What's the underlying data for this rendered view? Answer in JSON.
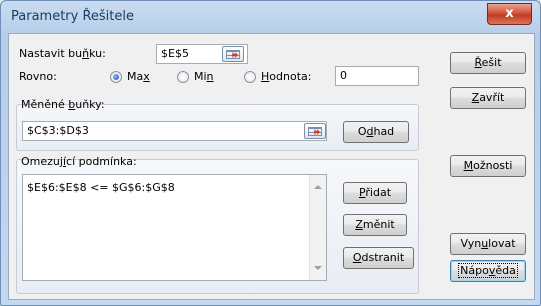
{
  "window": {
    "title": "Parametry Řešitele",
    "close_glyph": "x"
  },
  "target_cell": {
    "label": "Nastavit buňku:",
    "value": "$E$5"
  },
  "equal_to": {
    "label": "Rovno:",
    "options": [
      {
        "label": "Max",
        "checked": true
      },
      {
        "label": "Min",
        "checked": false
      },
      {
        "label": "Hodnota:",
        "checked": false
      }
    ],
    "value_field": "0"
  },
  "changing_cells": {
    "label": "Měněné buňky:",
    "value": "$C$3:$D$3",
    "guess_button": "Odhad"
  },
  "constraints": {
    "label": "Omezující podmínka:",
    "items": [
      "$E$6:$E$8 <= $G$6:$G$8"
    ],
    "add_button": "Přidat",
    "change_button": "Změnit",
    "delete_button": "Odstranit"
  },
  "side_buttons": {
    "solve": "Řešit",
    "close": "Zavřít",
    "options": "Možnosti",
    "reset": "Vynulovat",
    "help": "Nápověda"
  },
  "icons": {
    "ref_button": "range-select-icon",
    "radio": "radio-icon"
  }
}
